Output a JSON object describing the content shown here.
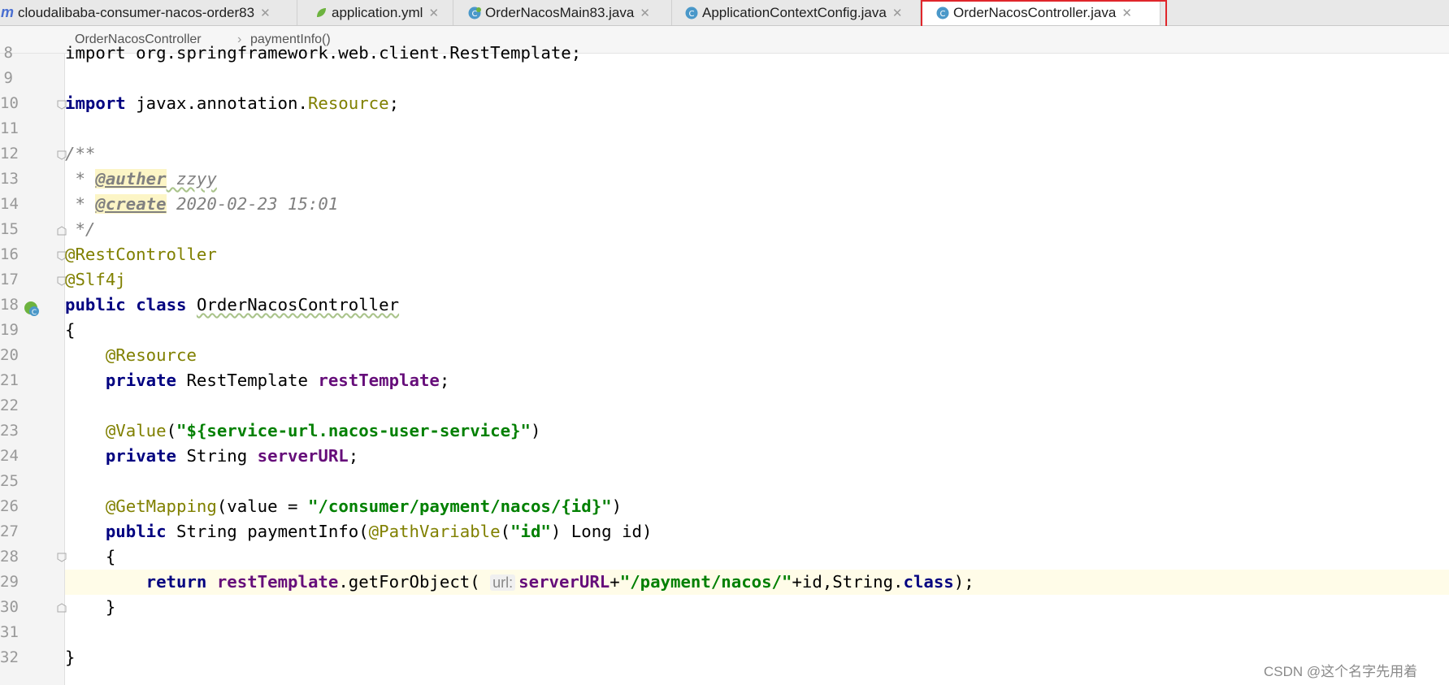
{
  "tabs": [
    {
      "label": "cloudalibaba-consumer-nacos-order83",
      "icon": "module-icon",
      "active": false
    },
    {
      "label": "application.yml",
      "icon": "yaml-leaf-icon",
      "active": false
    },
    {
      "label": "OrderNacosMain83.java",
      "icon": "spring-class-icon",
      "active": false
    },
    {
      "label": "ApplicationContextConfig.java",
      "icon": "class-icon",
      "active": false
    },
    {
      "label": "OrderNacosController.java",
      "icon": "class-icon",
      "active": true
    }
  ],
  "breadcrumb": {
    "class": "OrderNacosController",
    "separator": "›",
    "method": "paymentInfo()"
  },
  "code": {
    "line_numbers": [
      "8",
      "9",
      "10",
      "11",
      "12",
      "13",
      "14",
      "15",
      "16",
      "17",
      "18",
      "19",
      "20",
      "21",
      "22",
      "23",
      "24",
      "25",
      "26",
      "27",
      "28",
      "29",
      "30",
      "31",
      "32"
    ],
    "import_spring": "import org.springframework.web.client.RestTemplate;",
    "import_kw": "import",
    "import_pkg": " javax.annotation.",
    "import_class": "Resource",
    "semicolon": ";",
    "doc_open": "/**",
    "doc_star": " * ",
    "doc_author_tag": "@auther",
    "doc_author_val": " zzyy",
    "doc_create_tag": "@create",
    "doc_create_val": " 2020-02-23 15:01",
    "doc_close": " */",
    "ann_restcontroller": "@RestController",
    "ann_slf4j": "@Slf4j",
    "kw_public": "public",
    "kw_class": "class",
    "class_name": "OrderNacosController",
    "brace_open": "{",
    "brace_close": "}",
    "ann_resource": "@Resource",
    "kw_private": "private",
    "type_resttemplate": " RestTemplate ",
    "field_resttemplate": "restTemplate",
    "ann_value": "@Value",
    "value_arg": "\"${service-url.nacos-user-service}\"",
    "type_string": " String ",
    "field_serverurl": "serverURL",
    "ann_getmapping": "@GetMapping",
    "getmapping_pre": "(value = ",
    "getmapping_path": "\"/consumer/payment/nacos/{id}\"",
    "method_sig_mid": " String paymentInfo(",
    "ann_pathvariable": "@PathVariable",
    "pathvariable_arg": "\"id\"",
    "method_sig_end": ") Long id)",
    "kw_return": "return",
    "call_mid": ".getForObject( ",
    "param_hint": "url:",
    "concat1": "+",
    "payment_path": "\"/payment/nacos/\"",
    "concat2": "+id,String.",
    "call_end": ");",
    "paren_open": "(",
    "paren_close": ")"
  },
  "watermark": "CSDN @这个名字先用着",
  "colors": {
    "keyword": "#000080",
    "annotation": "#808000",
    "string": "#008000",
    "field": "#660e7a",
    "highlight_border": "#e0262b"
  }
}
